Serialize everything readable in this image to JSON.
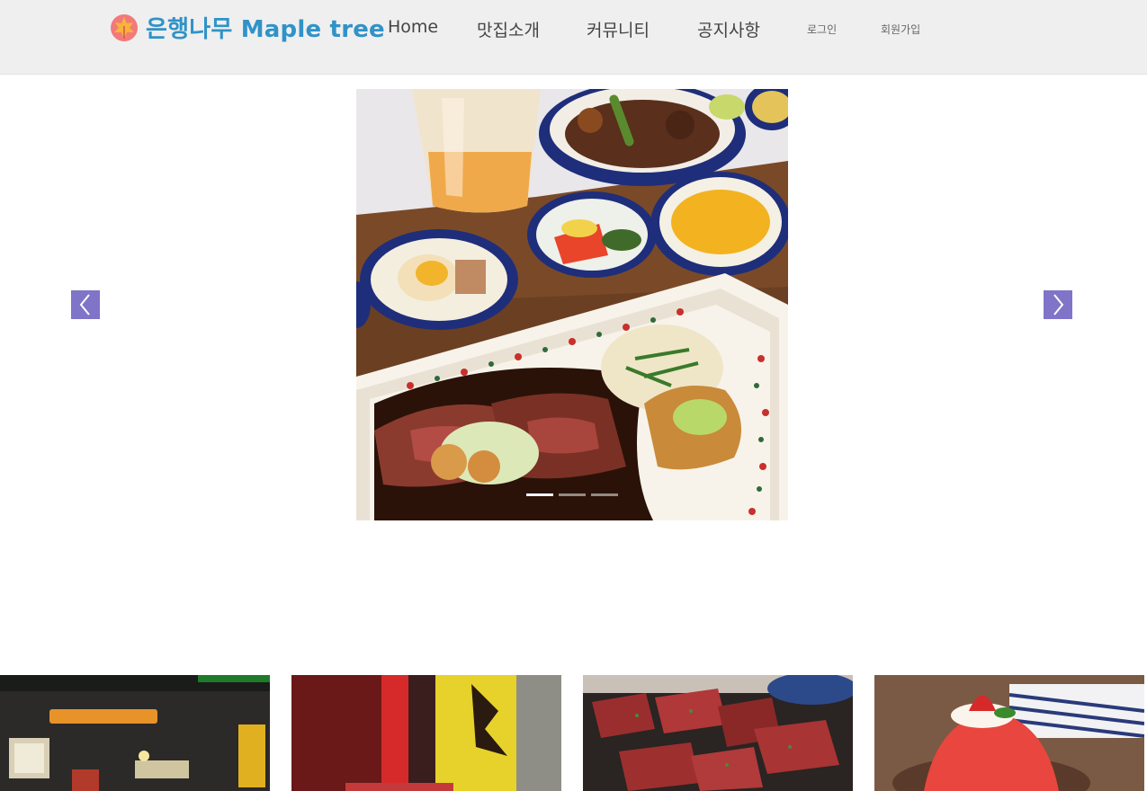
{
  "header": {
    "logo_text": "은행나무 Maple tree",
    "nav": [
      "Home",
      "맛집소개",
      "커뮤니티",
      "공지사항"
    ],
    "login_label": "로그인",
    "signup_label": "회원가입"
  },
  "carousel": {
    "slide_count": 3,
    "active_index": 0,
    "arrow_color": "#7f74c8"
  },
  "colors": {
    "brand": "#2f93c8",
    "header_bg": "#efefef"
  },
  "icons": [
    "maple-leaf-logo-icon",
    "chevron-left-icon",
    "chevron-right-icon"
  ]
}
